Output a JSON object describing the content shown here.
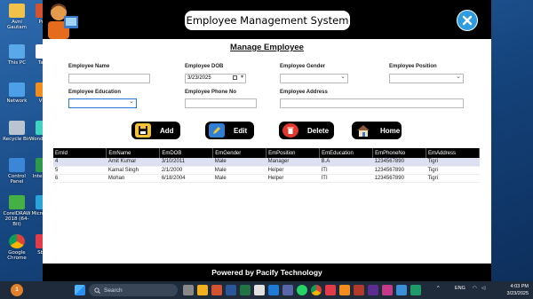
{
  "desktop": {
    "icons": [
      {
        "label": "Avni Gautam"
      },
      {
        "label": "Pow"
      },
      {
        "label": "This PC"
      },
      {
        "label": "Tally"
      },
      {
        "label": "Network"
      },
      {
        "label": "VLC"
      },
      {
        "label": "Recycle Bin"
      },
      {
        "label": "Wond Filmo"
      },
      {
        "label": "Control Panel"
      },
      {
        "label": "Inte Dow"
      },
      {
        "label": "CorelDRAW 2018 (64-Bit)"
      },
      {
        "label": "Micro Edg"
      },
      {
        "label": "Google Chrome"
      },
      {
        "label": "Sbicr"
      }
    ]
  },
  "app": {
    "title": "Employee Management System",
    "subtitle": "Manage Employee",
    "fields": {
      "name_label": "Employee Name",
      "name_value": "",
      "dob_label": "Employee DOB",
      "dob_value": "3/23/2025",
      "gender_label": "Employee Gender",
      "gender_value": "",
      "position_label": "Employee Position",
      "position_value": "",
      "education_label": "Employee Education",
      "education_value": "",
      "phone_label": "Employee Phone No",
      "phone_value": "",
      "address_label": "Employee Address",
      "address_value": ""
    },
    "buttons": {
      "add": "Add",
      "edit": "Edit",
      "delete": "Delete",
      "home": "Home"
    },
    "table": {
      "columns": [
        "EmId",
        "EmName",
        "EmDOB",
        "EmGender",
        "EmPosition",
        "EmEducation",
        "EmPhoneNo",
        "EmAddress"
      ],
      "rows": [
        [
          "4",
          "Amit Kumar",
          "3/10/2011",
          "Male",
          "Manager",
          "B.A",
          "1234567890",
          "Tigri"
        ],
        [
          "5",
          "Kamal Singh",
          "2/1/2000",
          "Male",
          "Helper",
          "ITI",
          "1234567890",
          "Tigri"
        ],
        [
          "6",
          "Mohan",
          "6/18/2004",
          "Male",
          "Helper",
          "ITI",
          "1234567890",
          "Tigri"
        ]
      ]
    },
    "footer": "Powered by Pacify Technology"
  },
  "taskbar": {
    "search_placeholder": "Search",
    "language": "ENG",
    "time": "4:03 PM",
    "date": "3/23/2025",
    "weather_badge": "1"
  },
  "colors": {
    "accent": "#2f9be0",
    "window_bg": "#000000",
    "panel_bg": "#ffffff",
    "selected_row": "#dde0f0"
  }
}
